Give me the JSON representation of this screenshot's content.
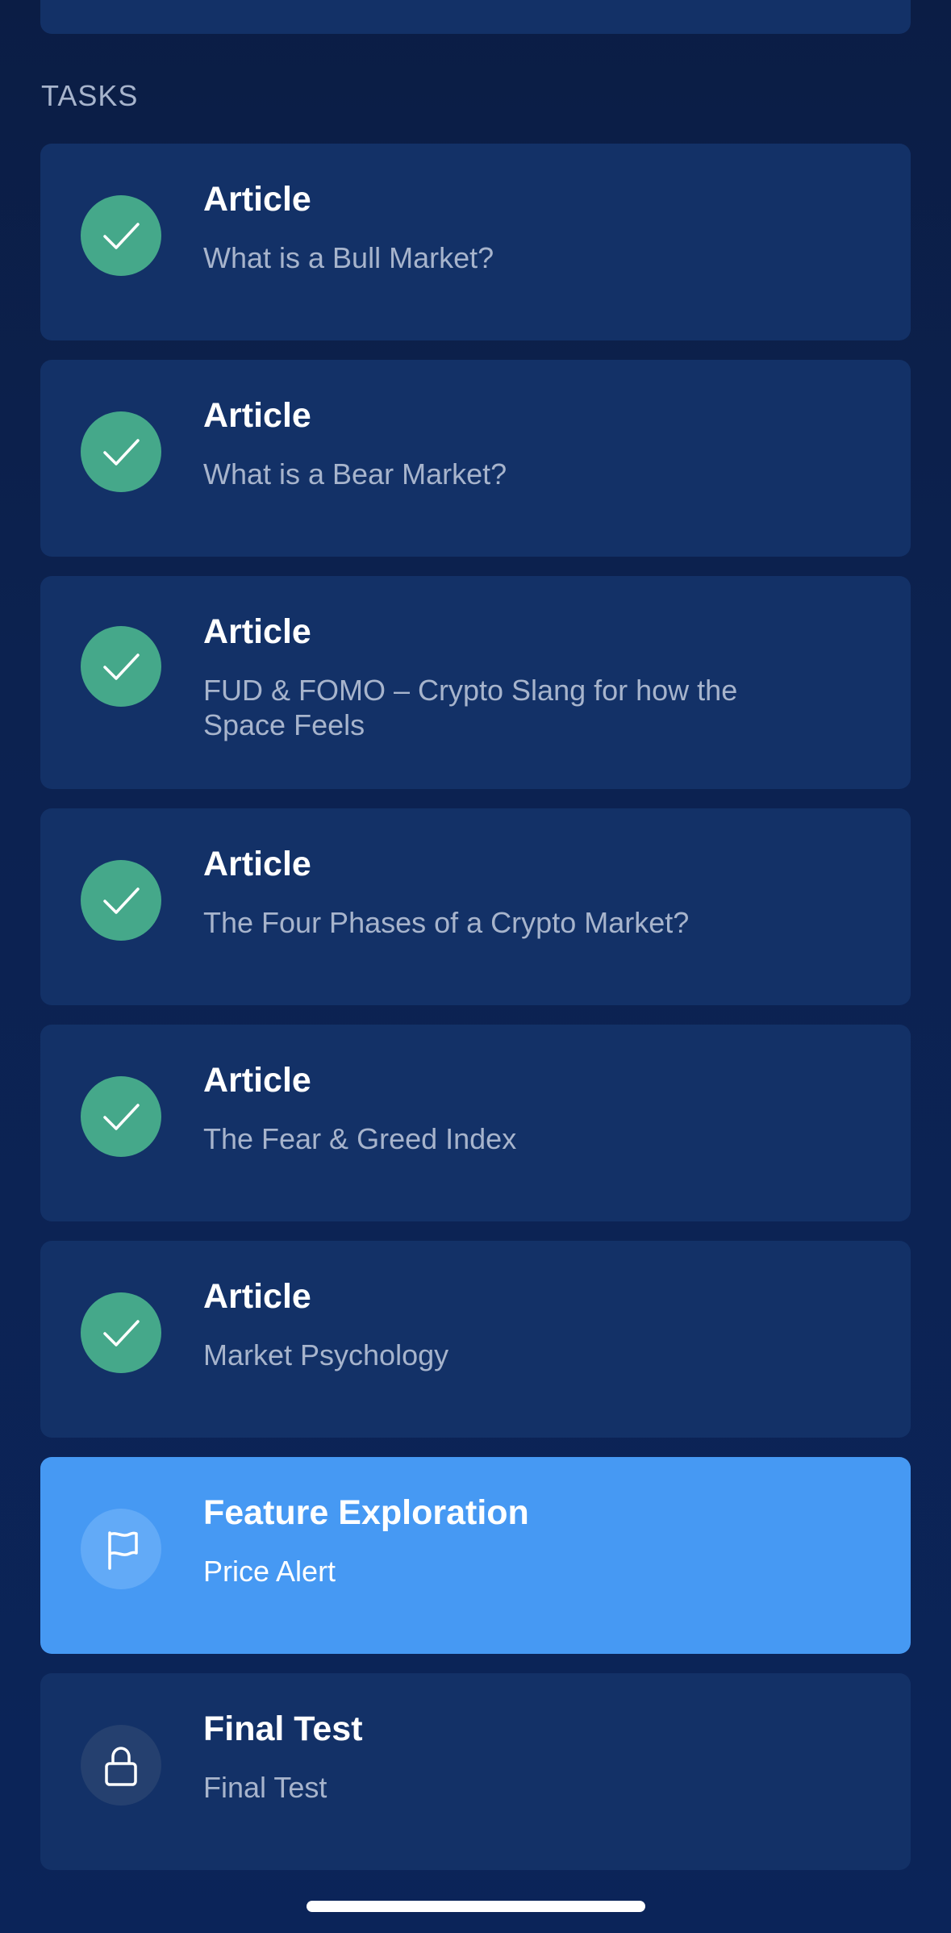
{
  "section": {
    "title": "TASKS"
  },
  "tasks": [
    {
      "type": "Article",
      "title": "What is a Bull Market?",
      "status": "completed",
      "icon": "checkmark-icon"
    },
    {
      "type": "Article",
      "title": "What is a Bear Market?",
      "status": "completed",
      "icon": "checkmark-icon"
    },
    {
      "type": "Article",
      "title": "FUD & FOMO – Crypto Slang for how the Space Feels",
      "status": "completed",
      "icon": "checkmark-icon"
    },
    {
      "type": "Article",
      "title": "The Four Phases of a Crypto Market?",
      "status": "completed",
      "icon": "checkmark-icon"
    },
    {
      "type": "Article",
      "title": "The Fear & Greed Index",
      "status": "completed",
      "icon": "checkmark-icon"
    },
    {
      "type": "Article",
      "title": "Market Psychology",
      "status": "completed",
      "icon": "checkmark-icon"
    },
    {
      "type": "Feature Exploration",
      "title": "Price Alert",
      "status": "current",
      "icon": "flag-icon"
    },
    {
      "type": "Final Test",
      "title": "Final Test",
      "status": "locked",
      "icon": "lock-icon"
    }
  ],
  "colors": {
    "background": "#0b1d45",
    "card": "#133167",
    "active_card": "#4699f3",
    "completed": "#45a88a",
    "muted_text": "#a7b4cc"
  }
}
